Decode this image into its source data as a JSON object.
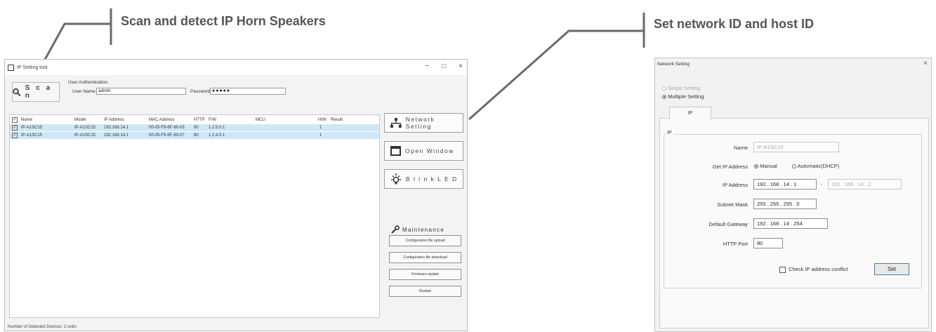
{
  "callouts": {
    "left": "Scan and detect IP Horn Speakers",
    "right": "Set network ID and host ID"
  },
  "app": {
    "title": "IP Setting tool",
    "window_controls": [
      "−",
      "□",
      "×"
    ],
    "scan_label": "S c a n",
    "auth": {
      "title": "User Authentication",
      "user_label": "User Name",
      "user_value": "admin",
      "password_label": "Password",
      "password_value": "●●●●●"
    },
    "table": {
      "headers": [
        "Name",
        "Model",
        "IP Address",
        "MAC Address",
        "HTTP",
        "F/W",
        "MCU",
        "H/W",
        "Result"
      ],
      "rows": [
        [
          "IP-A1SC15",
          "IP-A1SC15",
          "192.168.14.1",
          "00-05-F9-6F-80-03",
          "80",
          "1.2.5.0.1",
          "",
          "1",
          ""
        ],
        [
          "IP-A1SC15",
          "IP-A1SC15",
          "192.168.14.1",
          "00-05-F9-6F-80-07",
          "80",
          "1.2.4.0.1",
          "",
          "1",
          ""
        ]
      ]
    },
    "buttons": {
      "network_setting": "Network Setting",
      "open_window": "Open Window",
      "blink_led": "B l i n k  L E D"
    },
    "maintenance": {
      "title": "Maintenance",
      "config_upload": "Configuration file upload",
      "config_download": "Configuration file download",
      "firmware_update": "Firmware update",
      "restart": "Restart"
    },
    "status": "Number of Detected Devices: 2 units"
  },
  "dialog": {
    "title": "Network Setting",
    "close": "×",
    "single_setting": "Single Setting",
    "multiple_setting": "Multiple Setting",
    "tab": "IP",
    "group": "IP",
    "name_label": "Name",
    "name_value": "IP-A1SC15",
    "get_ip_label": "Get IP Address",
    "manual": "Manual",
    "automatic": "Automatic(DHCP)",
    "ip_label": "IP Address",
    "ip_from": "192 . 168 . 14 . 1",
    "ip_sep": "-",
    "ip_to": "192 . 168 . 14 . 2",
    "subnet_label": "Subnet Mask",
    "subnet_value": "255 . 255 . 255 . 0",
    "gateway_label": "Default Gateway",
    "gateway_value": "192 . 168 . 14 . 254",
    "port_label": "HTTP Port",
    "port_value": "80",
    "conflict_label": "Check IP address conflict",
    "set": "Set"
  }
}
